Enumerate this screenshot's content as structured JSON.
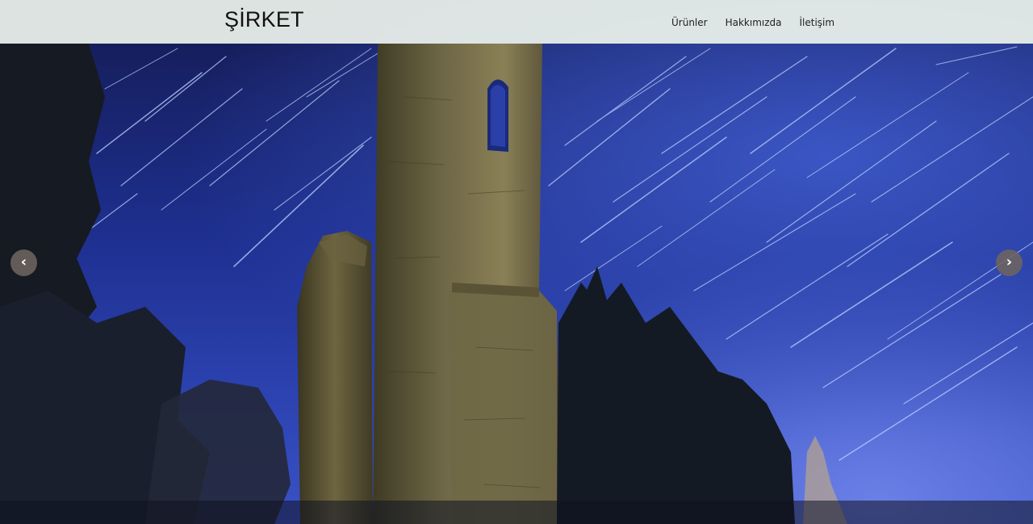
{
  "brand": {
    "name": "ŞİRKET"
  },
  "nav": {
    "items": [
      {
        "label": "Ürünler"
      },
      {
        "label": "Hakkımızda"
      },
      {
        "label": "İletişim"
      }
    ]
  },
  "carousel": {
    "prev_label": "‹",
    "next_label": "›",
    "slide_description": "Stone tower ruin at night with star trails and trees"
  },
  "colors": {
    "navbar_bg": "#ecf2ec",
    "sky": "#2c42b0",
    "arrow_bg": "#6e645f"
  }
}
